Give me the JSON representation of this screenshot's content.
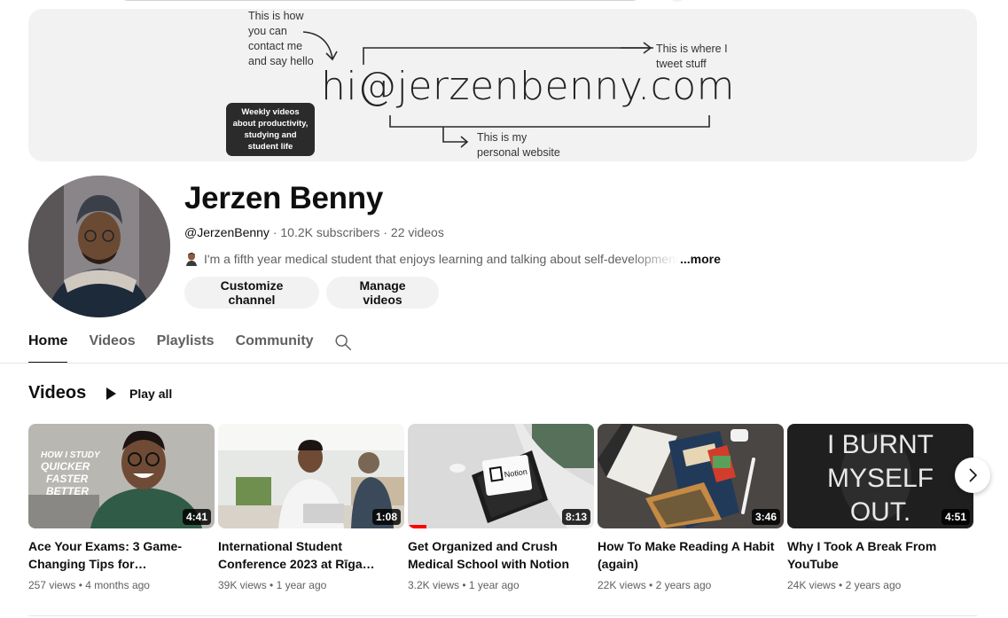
{
  "banner": {
    "contact_note": "This is how\nyou can\ncontact me\nand say hello",
    "email": "hi@jerzenbenny.com",
    "tweet_note": "This is where I\ntweet stuff",
    "site_note": "This is my\npersonal website",
    "badge": "Weekly videos about productivity, studying and student life"
  },
  "channel": {
    "name": "Jerzen Benny",
    "handle": "@JerzenBenny",
    "subscribers": "10.2K subscribers",
    "video_count": "22 videos",
    "description": "I'm a fifth year medical student that enjoys learning and talking about self-development",
    "more_label": "...more",
    "customize_label": "Customize channel",
    "manage_label": "Manage videos"
  },
  "tabs": [
    {
      "label": "Home",
      "active": true
    },
    {
      "label": "Videos",
      "active": false
    },
    {
      "label": "Playlists",
      "active": false
    },
    {
      "label": "Community",
      "active": false
    }
  ],
  "section": {
    "title": "Videos",
    "play_all_label": "Play all"
  },
  "videos": [
    {
      "title": "Ace Your Exams: 3 Game-Changing Tips for…",
      "views": "257 views",
      "age": "4 months ago",
      "duration": "4:41",
      "thumb_text": [
        "HOW I STUDY",
        "QUICKER",
        "FASTER",
        "BETTER"
      ]
    },
    {
      "title": "International Student Conference 2023 at Rīga…",
      "views": "39K views",
      "age": "1 year ago",
      "duration": "1:08"
    },
    {
      "title": "Get Organized and Crush Medical School with Notion",
      "views": "3.2K views",
      "age": "1 year ago",
      "duration": "8:13",
      "watched_fraction": 0.1,
      "thumb_text": [
        "Notion"
      ]
    },
    {
      "title": "How To Make Reading A Habit (again)",
      "views": "22K views",
      "age": "2 years ago",
      "duration": "3:46"
    },
    {
      "title": "Why I Took A Break From YouTube",
      "views": "24K views",
      "age": "2 years ago",
      "duration": "4:51",
      "thumb_text": [
        "I BURNT",
        "MYSELF",
        "OUT."
      ]
    }
  ],
  "icons": {
    "search": "search-icon",
    "play": "play-icon",
    "next": "chevron-right-icon"
  },
  "colors": {
    "text": "#0f0f0f",
    "secondary": "#606060",
    "chip": "#f2f2f2",
    "progress": "#ff0000"
  }
}
